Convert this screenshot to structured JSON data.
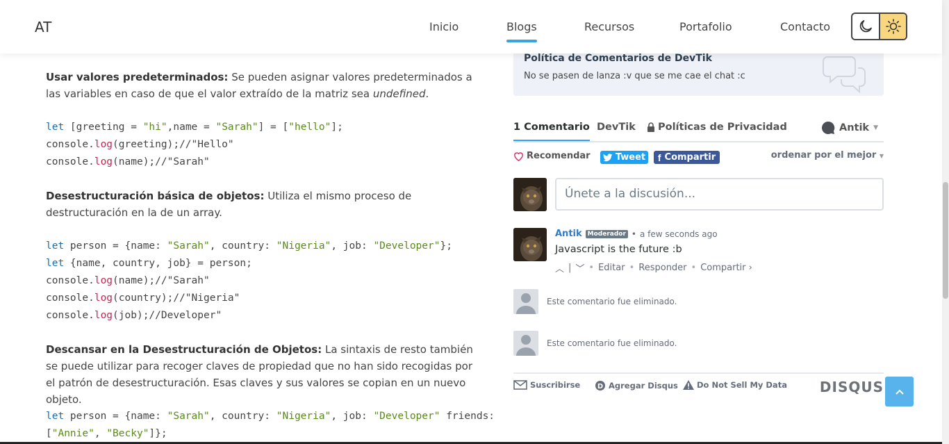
{
  "header": {
    "logo": "AT",
    "nav": [
      "Inicio",
      "Blogs",
      "Recursos",
      "Portafolio",
      "Contacto"
    ],
    "active_nav": "Blogs"
  },
  "article": {
    "p1_bold": "Usar valores predeterminados:",
    "p1_text": " Se pueden asignar valores predeterminados a las variables en caso de que el valor extraído de la matriz sea ",
    "p1_em": "undefined",
    "p1_end": ".",
    "code1": {
      "l1_kw": "let",
      "l1_a": " [greeting = ",
      "l1_s1": "\"hi\"",
      "l1_b": ",name = ",
      "l1_s2": "\"Sarah\"",
      "l1_c": "] = [",
      "l1_s3": "\"hello\"",
      "l1_d": "];",
      "l2_a": "console.",
      "l2_fn": "log",
      "l2_b": "(greeting);//\"Hello\"",
      "l3_a": "console.",
      "l3_fn": "log",
      "l3_b": "(name);//\"Sarah\""
    },
    "p2_bold": "Desestructuración básica de objetos:",
    "p2_text": " Utiliza el mismo proceso de destructuración en la de un array.",
    "code2": {
      "l1_kw": "let",
      "l1_a": " person = {name: ",
      "l1_s1": "\"Sarah\"",
      "l1_b": ", country: ",
      "l1_s2": "\"Nigeria\"",
      "l1_c": ", job: ",
      "l1_s3": "\"Developer\"",
      "l1_d": "};",
      "l2_kw": "let",
      "l2_a": " {name, country, job} = person;",
      "l3_a": "console.",
      "l3_fn": "log",
      "l3_b": "(name);//\"Sarah\"",
      "l4_a": "console.",
      "l4_fn": "log",
      "l4_b": "(country);//\"Nigeria\"",
      "l5_a": "console.",
      "l5_fn": "log",
      "l5_b": "(job);//Developer\""
    },
    "p3_bold": "Descansar en la Desestructuración de Objetos:",
    "p3_text": " La sintaxis de resto también se puede utilizar para recoger claves de propiedad que no han sido recogidas por el patrón de desestructuración. Esas claves y sus valores se copian en un nuevo objeto.",
    "code3": {
      "l1_kw": "let",
      "l1_a": " person = {name: ",
      "l1_s1": "\"Sarah\"",
      "l1_b": ", country: ",
      "l1_s2": "\"Nigeria\"",
      "l1_c": ", job: ",
      "l1_s3": "\"Developer\"",
      "l1_d": " friends:",
      "l2_a": "[",
      "l2_s1": "\"Annie\"",
      "l2_b": ", ",
      "l2_s2": "\"Becky\"",
      "l2_c": "]};"
    }
  },
  "disqus": {
    "policy_title": "Política de Comentarios de DevTik",
    "policy_text": "No se pasen de lanza :v que se me cae el chat :c",
    "tabs": [
      "1 Comentario",
      "DevTik",
      "Políticas de Privacidad"
    ],
    "user": "Antik",
    "recommend": "Recomendar",
    "tweet": "Tweet",
    "share": "Compartir",
    "sort": "ordenar por el mejor",
    "compose_placeholder": "Únete a la discusión...",
    "comment": {
      "author": "Antik",
      "badge": "Moderador",
      "time": "a few seconds ago",
      "text": "Javascript is the future :b",
      "actions": [
        "Editar",
        "Responder",
        "Compartir ›"
      ]
    },
    "deleted_text": "Este comentario fue eliminado.",
    "footer": [
      "Suscribirse",
      "Agregar Disqus",
      "Do Not Sell My Data"
    ],
    "logo": "DISQUS"
  },
  "colors": {
    "accent": "#3aa2e3",
    "sun_bg": "#f9d77e",
    "tweet": "#1da1f2",
    "facebook": "#3b5998",
    "to_top": "#58b3ec"
  }
}
